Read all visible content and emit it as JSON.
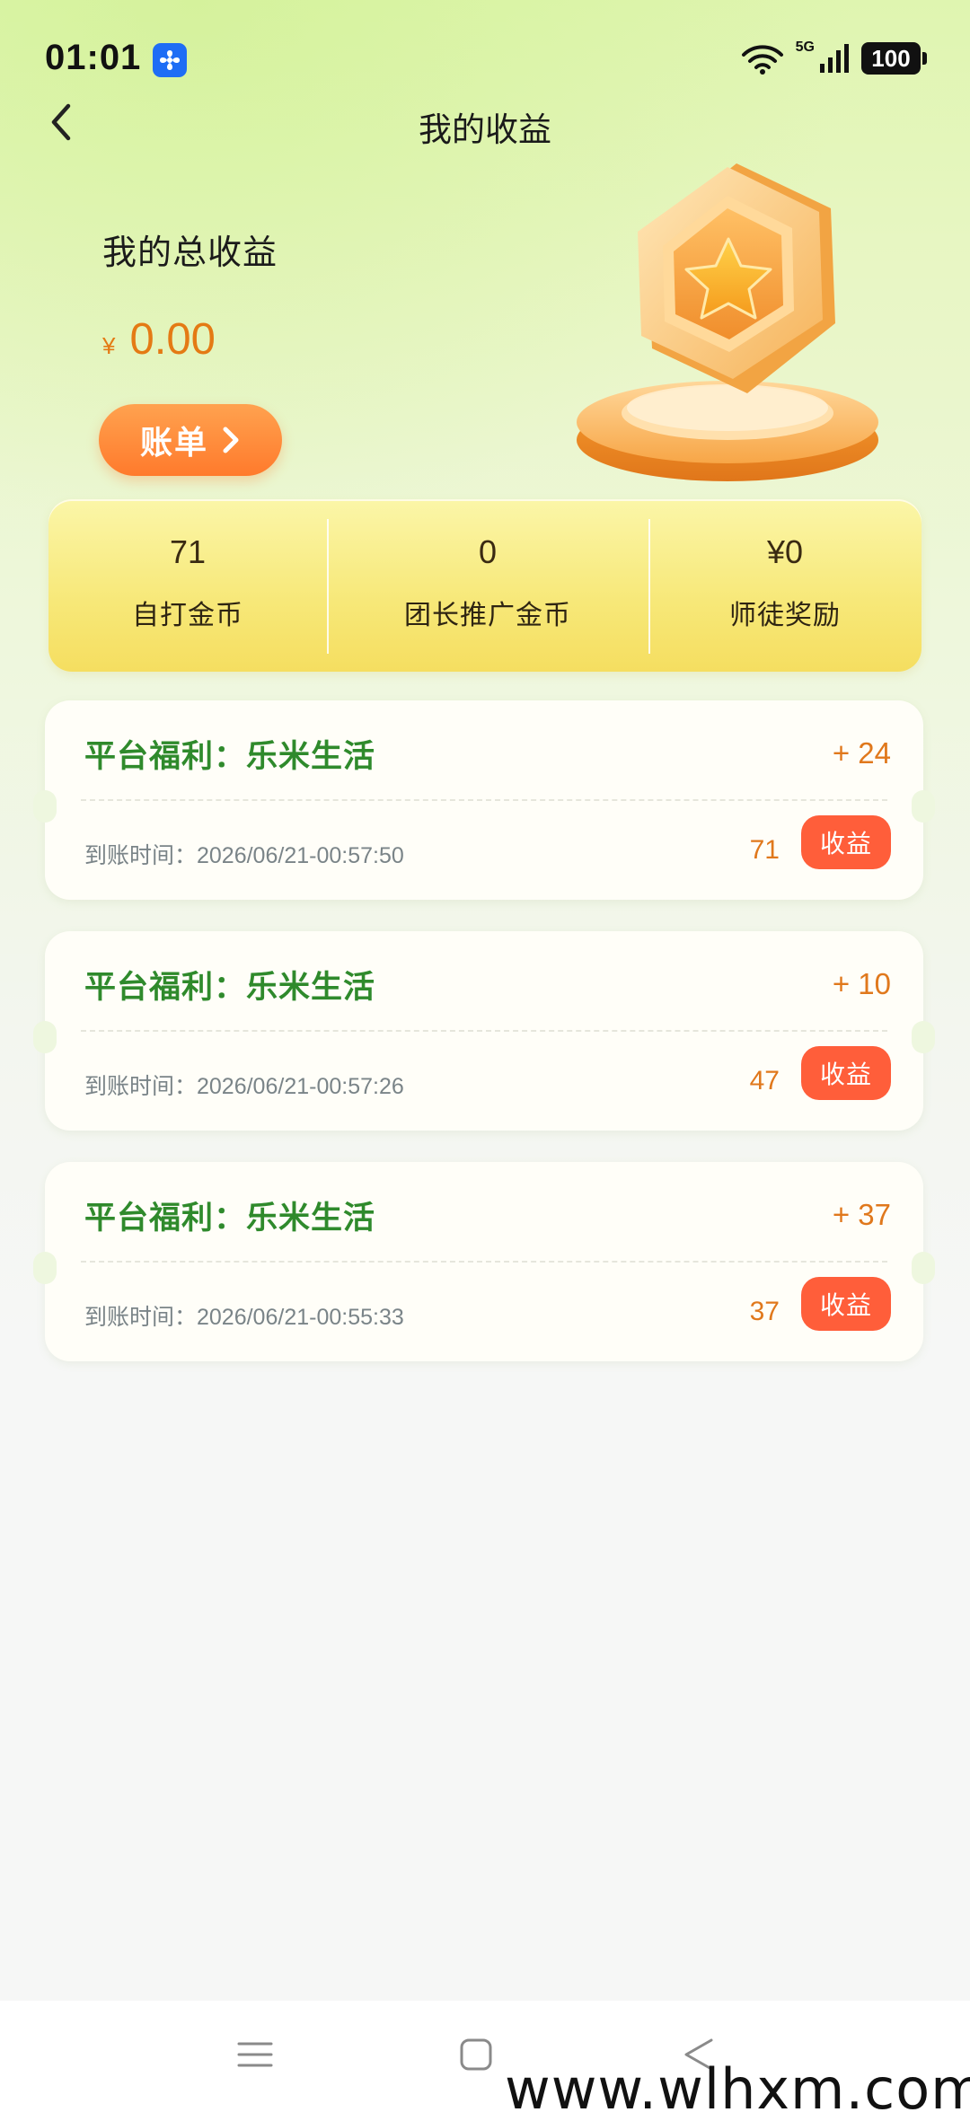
{
  "status_bar": {
    "time": "01:01",
    "network_label": "5G",
    "battery": "100"
  },
  "nav": {
    "title": "我的收益"
  },
  "summary": {
    "label": "我的总收益",
    "currency": "¥",
    "amount": "0.00",
    "bill_button": "账单"
  },
  "stats": [
    {
      "value": "71",
      "label": "自打金币"
    },
    {
      "value": "0",
      "label": "团长推广金币"
    },
    {
      "value": "¥0",
      "label": "师徒奖励"
    }
  ],
  "records": [
    {
      "title": "平台福利：乐米生活",
      "delta": "+ 24",
      "time": "到账时间：2026/06/21-00:57:50",
      "balance": "71",
      "tag": "收益"
    },
    {
      "title": "平台福利：乐米生活",
      "delta": "+ 10",
      "time": "到账时间：2026/06/21-00:57:26",
      "balance": "47",
      "tag": "收益"
    },
    {
      "title": "平台福利：乐米生活",
      "delta": "+ 37",
      "time": "到账时间：2026/06/21-00:55:33",
      "balance": "37",
      "tag": "收益"
    }
  ],
  "watermark": "www.wlhxm.com",
  "colors": {
    "accent_orange": "#ff7a2c",
    "amount_orange": "#e47a14",
    "title_green": "#2f8a2c",
    "tag_red": "#ff5e3a"
  }
}
